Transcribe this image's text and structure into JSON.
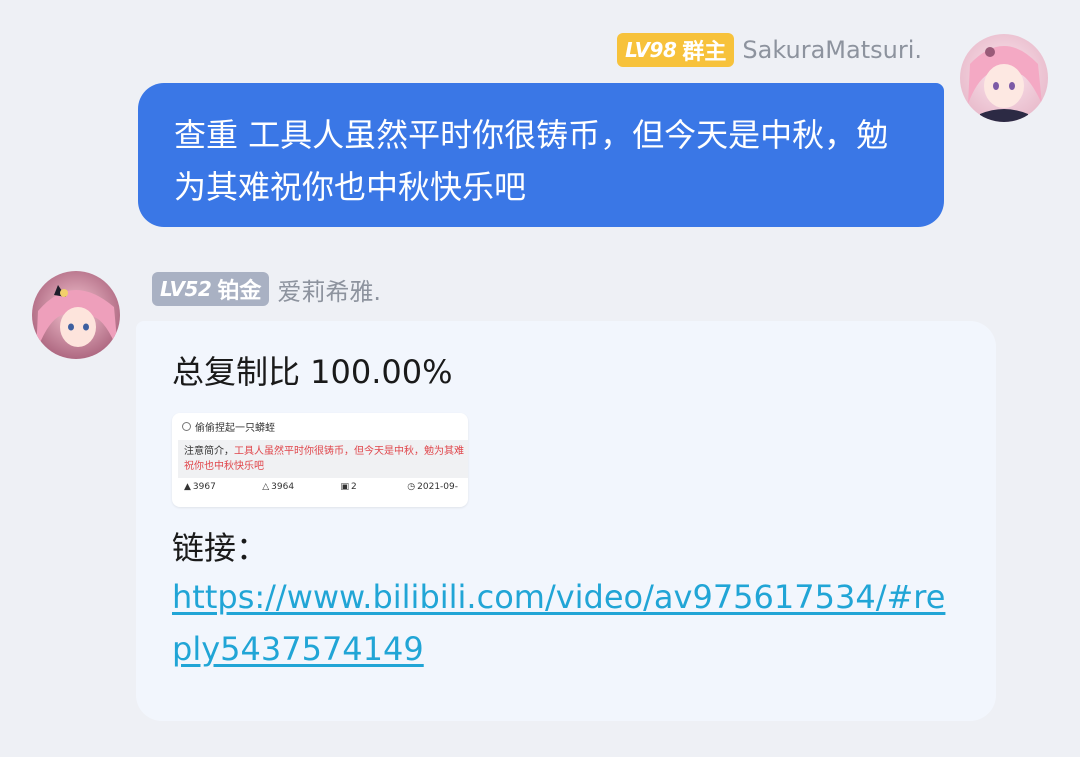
{
  "messages": [
    {
      "sender": {
        "level": "LV98",
        "title": "群主",
        "name": "SakuraMatsuri.",
        "badge_color": "#f7c23b"
      },
      "text": "查重 工具人虽然平时你很铸币，但今天是中秋，勉为其难祝你也中秋快乐吧",
      "bubble_color": "#3a77e6"
    },
    {
      "sender": {
        "level": "LV52",
        "title": "铂金",
        "name": "爱莉希雅.",
        "badge_color": "#a9b1c3"
      },
      "ratio_text": "总复制比 100.00%",
      "card": {
        "user": "偷偷捏起一只蟒蛭",
        "note_label": "注意简介，",
        "note_text": "工具人虽然平时你很铸币，但今天是中秋，勉为其难",
        "note_text_2": "祝你也中秋快乐吧",
        "likes": "3967",
        "thumbs": "3964",
        "replies": "2",
        "date": "2021-09-"
      },
      "link_label": "链接：",
      "link_url": "https://www.bilibili.com/video/av975617534/#reply5437574149",
      "bubble_color": "#f2f6fd"
    }
  ],
  "colors": {
    "background": "#eef0f5",
    "link": "#21a5d6",
    "nickname": "#8d939e"
  }
}
